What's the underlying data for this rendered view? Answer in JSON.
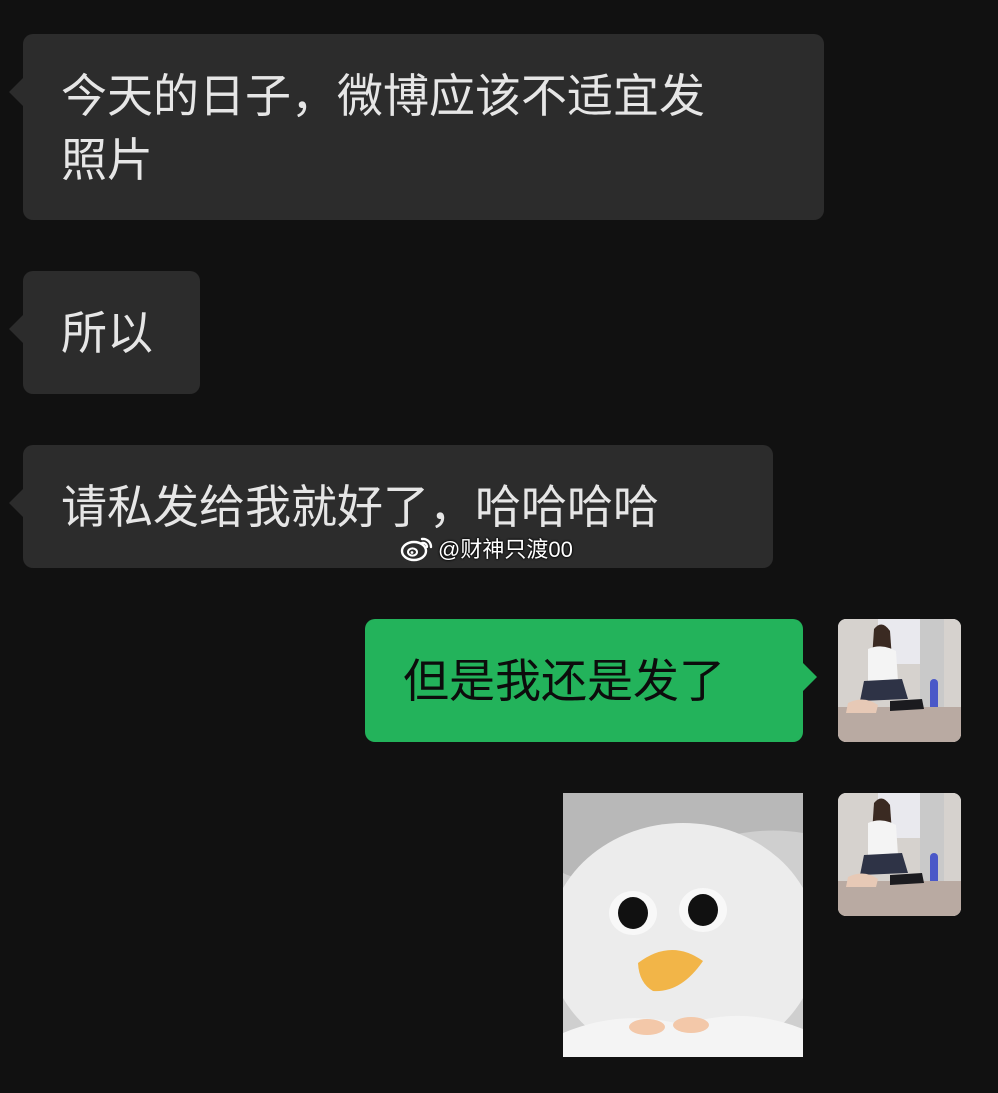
{
  "messages": [
    {
      "text": "今天的日子，微博应该不适宜发\n照片",
      "direction": "incoming"
    },
    {
      "text": "所以",
      "direction": "incoming"
    },
    {
      "text": "请私发给我就好了，哈哈哈哈",
      "direction": "incoming"
    },
    {
      "text": "但是我还是发了",
      "direction": "outgoing"
    },
    {
      "type": "sticker",
      "sticker_icon": "duck-pointing-sticker",
      "direction": "outgoing"
    }
  ],
  "watermark": {
    "text": "@财神只渡00",
    "icon": "weibo-logo-icon"
  },
  "colors": {
    "background": "#111111",
    "incoming_bubble": "#2c2c2c",
    "outgoing_bubble": "#23b35b",
    "incoming_text": "#e6e6e6",
    "outgoing_text": "#0c0c0c"
  }
}
